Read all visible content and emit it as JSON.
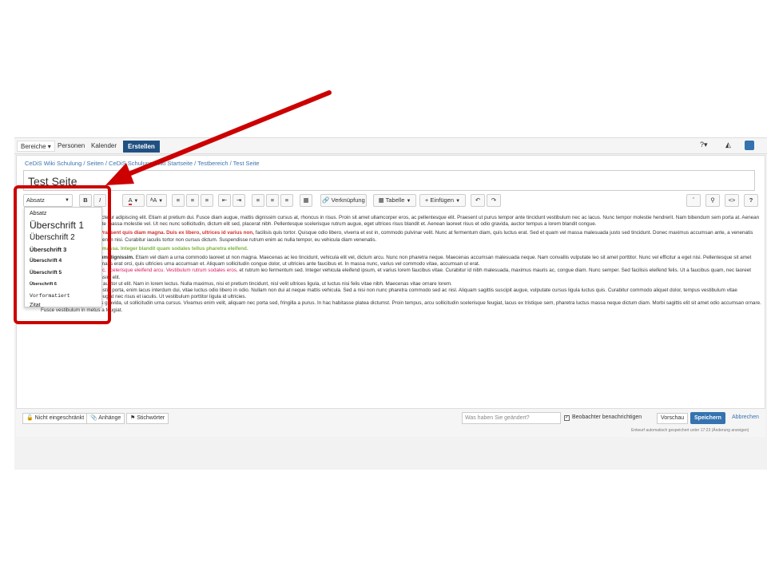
{
  "nav": {
    "spaces": "Bereiche ▾",
    "people": "Personen",
    "calendar": "Kalender",
    "create": "Erstellen",
    "help": "?▾"
  },
  "breadcrumb": "CeDiS Wiki Schulung  /  Seiten  /  CeDiS Schulungswiki Startseite  /  Testbereich  /  Test Seite",
  "page_title": "Test Seite",
  "toolbar": {
    "format_select": "Absatz",
    "bold": "B",
    "italic": "I",
    "color": "A",
    "more_format": "ᴬA",
    "link": "Verknüpfung",
    "table": "Tabelle",
    "insert": "Einfügen",
    "help": "?"
  },
  "format_menu": {
    "items": [
      "Absatz",
      "Überschrift 1",
      "Überschrift 2",
      "Überschrift 3",
      "Überschrift 4",
      "Überschrift 5",
      "Überschrift 6",
      "Vorformatiert",
      "Zitat"
    ]
  },
  "content": {
    "p1": "Lorem ipsum dolor sit amet, consectetur adipiscing elit. Etiam at pretium dui. Fusce diam augue, mattis dignissim cursus at, rhoncus in risus. Proin sit amet ullamcorper eros, ac pellentesque elit. Praesent ut purus tempor ante tincidunt vestibulum nec ac lacus. Nunc tempor molestie hendrerit. Nam bibendum sem porta at. Aenean rutrum pellentesque dui, at vulputate massa molestie vel. Ut nec nunc sollicitudin, dictum elit sed, placerat nibh. Pellentesque scelerisque rutrum augue, eget ultrices risus blandit et. Aenean laoreet risus et odio gravida, auctor tempus a lorem blandit congue.",
    "p2_red": "Aliquam quis vel pellentesque. Praesent quis diam magna. Duis ex libero, ultrices id varius non,",
    "p2_rest": " facilisis quis tortor. Quisque odio libero, viverra et est in, commodo pulvinar velit. Nunc at fermentum diam, quis luctus erat. Sed et quam vel massa malesuada justo sed tincidunt. Donec maximus accumsan ante, a venenatis urna egestas iaculis. Morbi blandit enim nisi. Curabitur iaculis tortor non cursus dictum. Suspendisse rutrum enim ac nulla tempor, eu vehicula diam venenatis.",
    "p3_green": "Nunc tincidunt ligula ac gravida massa. Integer blandit quam sodales tellus pharetra eleifend.",
    "li1_bold": "Proin vitae justo elementum dignissim.",
    "li1": " Etiam vel diam a urna commodo laoreet ut non magna. Maecenas ac leo tincidunt, vehicula elit vel, dictum arcu. Nunc non pharetra neque. Maecenas accumsan malesuada neque. Nam convallis vulputate leo sit amet porttitor. Nunc vel efficitur a eget nisi. Pellentesque sit amet feugiat tellus. Aliquam venenatis erat orci, quis ultricies urna accumsan et. Aliquam sollicitudin congue dolor, ut ultricies ante faucibus et. In massa nunc, varius vel commodo vitae, accumsan ut erat.",
    "li2_pink": "Quisque bibendum eu est ac, scelerisque eleifend arcu. Vestibulum rutrum sodales eros,",
    "li2": " et rutrum leo fermentum sed. Integer vehicula eleifend ipsum, et varius lorem faucibus vitae. Curabitur id nibh malesuada, maximus mauris ac, congue diam. Nunc semper. Sed facilisis eleifend felis. Ut a faucibus quam, nec laoreet diam. Suspendisse in dignissim elit.",
    "li3": "Donec tincidunt in mollis id, auctor ut elit. Nam in lorem lectus. Nulla maximus, nisi et pretium tincidunt, nisl velit ultrices ligula, ut luctus nisi felis vitae nibh. Maecenas vitae ornare lorem.",
    "li4": "Donec viverra, justo id molestie porta, enim lacus interdum dui, vitae luctus odio libero in odio. Nullam non dui at neque mattis vehicula. Sed a nisi non nunc pharetra commodo sed ac nisl. Aliquam sagittis suscipit augue, vulputate cursus ligula luctus quis. Curabitur commodo aliquet dolor, tempus vestibulum vitae condimentum vel. Integer feugiat nec risus et iaculis. Ut vestibulum porttitor ligula id ultricies.",
    "li5": "Aenean mollis tortor ac eros gravida, ut sollicitudin urna cursus. Vivamus enim velit, aliquam nec porta sed, fringilla a purus. In hac habitasse platea dictumst. Proin tempus, arcu sollicitudin scelerisque feugiat, lacus ex tristique sem, pharetra luctus massa neque dictum diam. Morbi sagittis elit sit amet odio accumsan ornare. Fusce vestibulum in metus a feugiat."
  },
  "footer": {
    "restrictions": "Nicht eingeschränkt",
    "attachments": "Anhänge",
    "labels": "Stichwörter",
    "change_placeholder": "Was haben Sie geändert?",
    "notify_watchers": "Beobachter benachrichtigen",
    "preview": "Vorschau",
    "save": "Speichern",
    "cancel": "Abbrechen",
    "autosave": "Entwurf automatisch gespeichert unter 17:23 (Änderung anzeigen)"
  },
  "colors": {
    "accent": "#205081",
    "annotation": "#cc0000"
  }
}
